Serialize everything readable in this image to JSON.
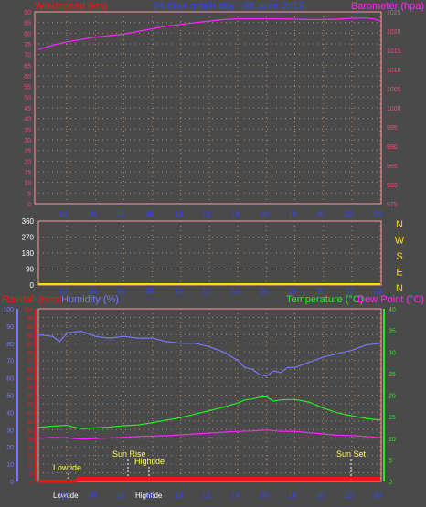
{
  "colors": {
    "background": "#4a4a4a",
    "axis_pink": "#ff4477",
    "grid_dot": "#b08a6a",
    "title_blue": "#3344ff",
    "barometer": "#ff22ff",
    "wind": "#ffdd00",
    "humidity": "#7777ff",
    "temperature": "#22ee22",
    "dew_point": "#ff22ff",
    "rain": "#ff1111",
    "frame": "#ff9999",
    "event_white": "#ffffff",
    "event_yellow": "#ffff55"
  },
  "header": {
    "left_label": "Windspeed (kts)",
    "title": "24 hour graph day : 08 June 2019",
    "right_label": "Barometer (hpa)"
  },
  "time_ticks": [
    "02",
    "04",
    "06",
    "08",
    "10",
    "12",
    "14",
    "16",
    "18",
    "20",
    "22",
    "00"
  ],
  "direction_letters": [
    "N",
    "W",
    "S",
    "E",
    "N"
  ],
  "bottom_header": {
    "rainfall_label": "Rainfall (mm)",
    "humidity_label": "Humidity (%)",
    "temperature_label": "Temperature (°C)",
    "dewpoint_label": "Dew Point (°C)"
  },
  "events": {
    "lowtide": "Lowtide",
    "sun_rise": "Sun Rise",
    "hightide": "Hightide",
    "sun_set": "Sun Set",
    "lowtide_bottom": "Lowtide",
    "hightide_bottom": "Hightide"
  },
  "chart_data": [
    {
      "type": "line",
      "title": "24 hour graph day : 08 June 2019",
      "x_ticks": [
        "02",
        "04",
        "06",
        "08",
        "10",
        "12",
        "14",
        "16",
        "18",
        "20",
        "22",
        "00"
      ],
      "left_axis": {
        "label": "Windspeed (kts)",
        "ticks": [
          0,
          5,
          10,
          15,
          20,
          25,
          30,
          35,
          40,
          45,
          50,
          55,
          60,
          65,
          70,
          75,
          80,
          85,
          90
        ],
        "ylim": [
          0,
          90
        ]
      },
      "right_axis": {
        "label": "Barometer (hpa)",
        "ticks": [
          975,
          980,
          985,
          990,
          995,
          1000,
          1005,
          1010,
          1015,
          1020,
          1025
        ],
        "ylim": [
          975,
          1025
        ]
      },
      "series": [
        {
          "name": "Barometer (hpa)",
          "axis": "right",
          "x": [
            0,
            1,
            2,
            3,
            4,
            5,
            6,
            7,
            8,
            9,
            10,
            11,
            12,
            13,
            14,
            15,
            16,
            17,
            18,
            19,
            20,
            21,
            22,
            23,
            23.5,
            24
          ],
          "values": [
            1015.2,
            1016.3,
            1017.2,
            1017.8,
            1018.4,
            1018.8,
            1019.2,
            1019.9,
            1020.6,
            1021.3,
            1021.7,
            1022.2,
            1022.6,
            1023.0,
            1023.2,
            1023.2,
            1023.2,
            1023.2,
            1023.1,
            1023.0,
            1023.0,
            1023.1,
            1023.3,
            1023.4,
            1023.2,
            1022.7
          ]
        }
      ],
      "grid": true
    },
    {
      "type": "scatter",
      "left_axis": {
        "ticks": [
          0,
          90,
          180,
          270,
          360
        ],
        "ylim": [
          0,
          360
        ]
      },
      "right_axis": {
        "ticks": [
          "N",
          "W",
          "S",
          "E",
          "N"
        ]
      },
      "x_ticks": [
        "02",
        "04",
        "06",
        "08",
        "10",
        "12",
        "14",
        "16",
        "18",
        "20",
        "22",
        "00"
      ],
      "series": [
        {
          "x": [
            0,
            24
          ],
          "values": [
            0,
            0
          ]
        }
      ],
      "grid": true
    },
    {
      "type": "line",
      "x_ticks": [
        "02",
        "04",
        "06",
        "08",
        "10",
        "12",
        "14",
        "16",
        "18",
        "20",
        "22",
        "00"
      ],
      "humidity_axis": {
        "label": "Humidity (%)",
        "ticks": [
          0,
          10,
          20,
          30,
          40,
          50,
          60,
          70,
          80,
          90,
          100
        ],
        "ylim": [
          0,
          100
        ]
      },
      "rain_axis": {
        "label": "Rainfall (mm)",
        "ticks": [
          0,
          5,
          10,
          15,
          20,
          25,
          30,
          35,
          40,
          45,
          50,
          55,
          60,
          65,
          70,
          75,
          80,
          85,
          90,
          95,
          100
        ],
        "ylim": [
          0,
          100
        ]
      },
      "temp_axis": {
        "label": "Temperature (°C)",
        "ticks": [
          0,
          5,
          10,
          15,
          20,
          25,
          30,
          35,
          40
        ],
        "ylim": [
          0,
          40
        ]
      },
      "series": [
        {
          "name": "Humidity (%)",
          "axis": "humidity",
          "x": [
            0,
            1,
            1.5,
            2,
            3,
            4,
            5,
            6,
            7,
            8,
            9,
            10,
            11,
            12,
            13,
            14,
            14.5,
            15,
            15.5,
            16,
            16.5,
            17,
            17.5,
            18,
            19,
            20,
            21,
            22,
            23,
            24
          ],
          "values": [
            85,
            84,
            81,
            86,
            87,
            84,
            83,
            84,
            83,
            83,
            81,
            80,
            80,
            78,
            75,
            70,
            66,
            65,
            62,
            61,
            64,
            63,
            66,
            66,
            69,
            72,
            74,
            76,
            79,
            80
          ]
        },
        {
          "name": "Temperature (°C)",
          "axis": "temp",
          "x": [
            0,
            1,
            2,
            3,
            4,
            5,
            6,
            7,
            8,
            9,
            10,
            11,
            12,
            13,
            14,
            14.5,
            15,
            15.5,
            16,
            16.5,
            17,
            18,
            19,
            20,
            21,
            22,
            23,
            24
          ],
          "values": [
            12.5,
            12.8,
            13.0,
            12.2,
            12.4,
            12.6,
            12.9,
            13.1,
            13.6,
            14.2,
            14.8,
            15.6,
            16.4,
            17.2,
            18.2,
            18.9,
            19.1,
            19.5,
            19.6,
            18.6,
            18.9,
            19.0,
            18.4,
            17.0,
            15.9,
            15.2,
            14.6,
            14.2
          ]
        },
        {
          "name": "Dew Point (°C)",
          "axis": "temp",
          "x": [
            0,
            1,
            2,
            3,
            4,
            5,
            6,
            7,
            8,
            9,
            10,
            11,
            12,
            13,
            14,
            15,
            16,
            17,
            18,
            19,
            20,
            21,
            22,
            23,
            24
          ],
          "values": [
            10.0,
            10.2,
            10.1,
            9.8,
            9.9,
            10.1,
            10.2,
            10.4,
            10.5,
            10.6,
            10.8,
            11.0,
            11.2,
            11.4,
            11.6,
            11.7,
            11.9,
            11.6,
            11.6,
            11.3,
            11.0,
            10.7,
            10.6,
            10.4,
            10.1
          ]
        },
        {
          "name": "Rainfall (mm)",
          "axis": "rain",
          "x": [
            0,
            2.6,
            2.8,
            24
          ],
          "values": [
            0,
            0,
            1.9,
            1.9
          ]
        }
      ],
      "markers": [
        {
          "label": "Lowtide",
          "x": 2.4
        },
        {
          "label": "Sun Rise",
          "x": 6.3
        },
        {
          "label": "Hightide",
          "x": 7.9
        },
        {
          "label": "Sun Set",
          "x": 22.0
        }
      ],
      "grid": true
    }
  ]
}
